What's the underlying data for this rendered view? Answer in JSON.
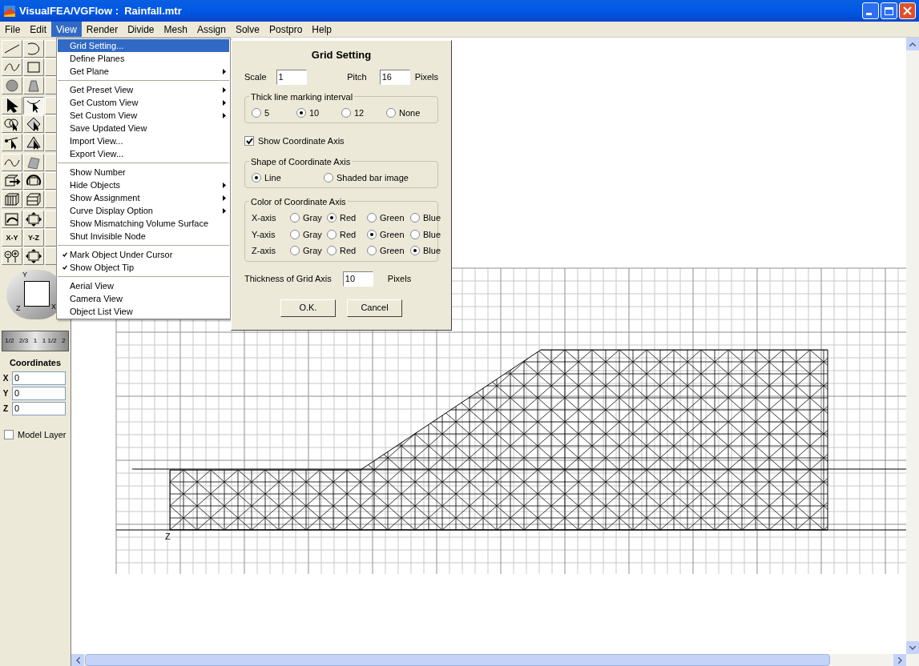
{
  "window": {
    "title": "VisualFEA/VGFlow :  Rainfall.mtr"
  },
  "menubar": [
    {
      "label": "File",
      "selected": false
    },
    {
      "label": "Edit",
      "selected": false
    },
    {
      "label": "View",
      "selected": true
    },
    {
      "label": "Render",
      "selected": false
    },
    {
      "label": "Divide",
      "selected": false
    },
    {
      "label": "Mesh",
      "selected": false
    },
    {
      "label": "Assign",
      "selected": false
    },
    {
      "label": "Solve",
      "selected": false
    },
    {
      "label": "Postpro",
      "selected": false
    },
    {
      "label": "Help",
      "selected": false
    }
  ],
  "view_menu": [
    {
      "kind": "item",
      "label": "Grid Setting...",
      "selected": true,
      "checked": false,
      "submenu": false
    },
    {
      "kind": "item",
      "label": "Define Planes",
      "selected": false,
      "checked": false,
      "submenu": false
    },
    {
      "kind": "item",
      "label": "Get Plane",
      "selected": false,
      "checked": false,
      "submenu": true
    },
    {
      "kind": "separator"
    },
    {
      "kind": "item",
      "label": "Get Preset View",
      "selected": false,
      "checked": false,
      "submenu": true
    },
    {
      "kind": "item",
      "label": "Get Custom View",
      "selected": false,
      "checked": false,
      "submenu": true
    },
    {
      "kind": "item",
      "label": "Set Custom View",
      "selected": false,
      "checked": false,
      "submenu": true
    },
    {
      "kind": "item",
      "label": "Save Updated View",
      "selected": false,
      "checked": false,
      "submenu": false
    },
    {
      "kind": "item",
      "label": "Import View...",
      "selected": false,
      "checked": false,
      "submenu": false
    },
    {
      "kind": "item",
      "label": "Export View...",
      "selected": false,
      "checked": false,
      "submenu": false
    },
    {
      "kind": "separator"
    },
    {
      "kind": "item",
      "label": "Show Number",
      "selected": false,
      "checked": false,
      "submenu": false
    },
    {
      "kind": "item",
      "label": "Hide Objects",
      "selected": false,
      "checked": false,
      "submenu": true
    },
    {
      "kind": "item",
      "label": "Show Assignment",
      "selected": false,
      "checked": false,
      "submenu": true
    },
    {
      "kind": "item",
      "label": "Curve Display Option",
      "selected": false,
      "checked": false,
      "submenu": true
    },
    {
      "kind": "item",
      "label": "Show Mismatching Volume Surface",
      "selected": false,
      "checked": false,
      "submenu": false
    },
    {
      "kind": "item",
      "label": "Shut Invisible Node",
      "selected": false,
      "checked": false,
      "submenu": false
    },
    {
      "kind": "separator"
    },
    {
      "kind": "item",
      "label": "Mark Object Under Cursor",
      "selected": false,
      "checked": true,
      "submenu": false
    },
    {
      "kind": "item",
      "label": "Show Object Tip",
      "selected": false,
      "checked": true,
      "submenu": false
    },
    {
      "kind": "separator"
    },
    {
      "kind": "item",
      "label": "Aerial View",
      "selected": false,
      "checked": false,
      "submenu": false
    },
    {
      "kind": "item",
      "label": "Camera View",
      "selected": false,
      "checked": false,
      "submenu": false
    },
    {
      "kind": "item",
      "label": "Object List View",
      "selected": false,
      "checked": false,
      "submenu": false
    }
  ],
  "toolbar": {
    "plane_buttons": [
      "X-Y",
      "Y-Z"
    ]
  },
  "view_widget": {
    "axis_labels": [
      "Y",
      "Z",
      "X"
    ]
  },
  "zoom_scale": [
    "1/2",
    "2/3",
    "1",
    "1 1/2",
    "2"
  ],
  "coordinates": {
    "title": "Coordinates",
    "fields": [
      {
        "label": "X",
        "value": "0"
      },
      {
        "label": "Y",
        "value": "0"
      },
      {
        "label": "Z",
        "value": "0"
      }
    ]
  },
  "model_layer": {
    "label": "Model Layer",
    "checked": false
  },
  "canvas": {
    "axis_label": "Z"
  },
  "dialog": {
    "title": "Grid Setting",
    "scale": {
      "label": "Scale",
      "value": "1"
    },
    "pitch": {
      "label": "Pitch",
      "value": "16",
      "unit": "Pixels"
    },
    "thick_line": {
      "title": "Thick line marking interval",
      "options": [
        {
          "label": "5",
          "selected": false
        },
        {
          "label": "10",
          "selected": true
        },
        {
          "label": "12",
          "selected": false
        },
        {
          "label": "None",
          "selected": false
        }
      ]
    },
    "show_axis": {
      "label": "Show Coordinate Axis",
      "checked": true
    },
    "shape": {
      "title": "Shape of Coordinate Axis",
      "options": [
        {
          "label": "Line",
          "selected": true
        },
        {
          "label": "Shaded bar image",
          "selected": false
        }
      ]
    },
    "color": {
      "title": "Color of Coordinate Axis",
      "rows": [
        {
          "axis": "X-axis",
          "options": [
            {
              "label": "Gray",
              "selected": false
            },
            {
              "label": "Red",
              "selected": true
            },
            {
              "label": "Green",
              "selected": false
            },
            {
              "label": "Blue",
              "selected": false
            }
          ]
        },
        {
          "axis": "Y-axis",
          "options": [
            {
              "label": "Gray",
              "selected": false
            },
            {
              "label": "Red",
              "selected": false
            },
            {
              "label": "Green",
              "selected": true
            },
            {
              "label": "Blue",
              "selected": false
            }
          ]
        },
        {
          "axis": "Z-axis",
          "options": [
            {
              "label": "Gray",
              "selected": false
            },
            {
              "label": "Red",
              "selected": false
            },
            {
              "label": "Green",
              "selected": false
            },
            {
              "label": "Blue",
              "selected": true
            }
          ]
        }
      ]
    },
    "thickness": {
      "label": "Thickness of Grid Axis",
      "value": "10",
      "unit": "Pixels"
    },
    "buttons": [
      "O.K.",
      "Cancel"
    ]
  }
}
